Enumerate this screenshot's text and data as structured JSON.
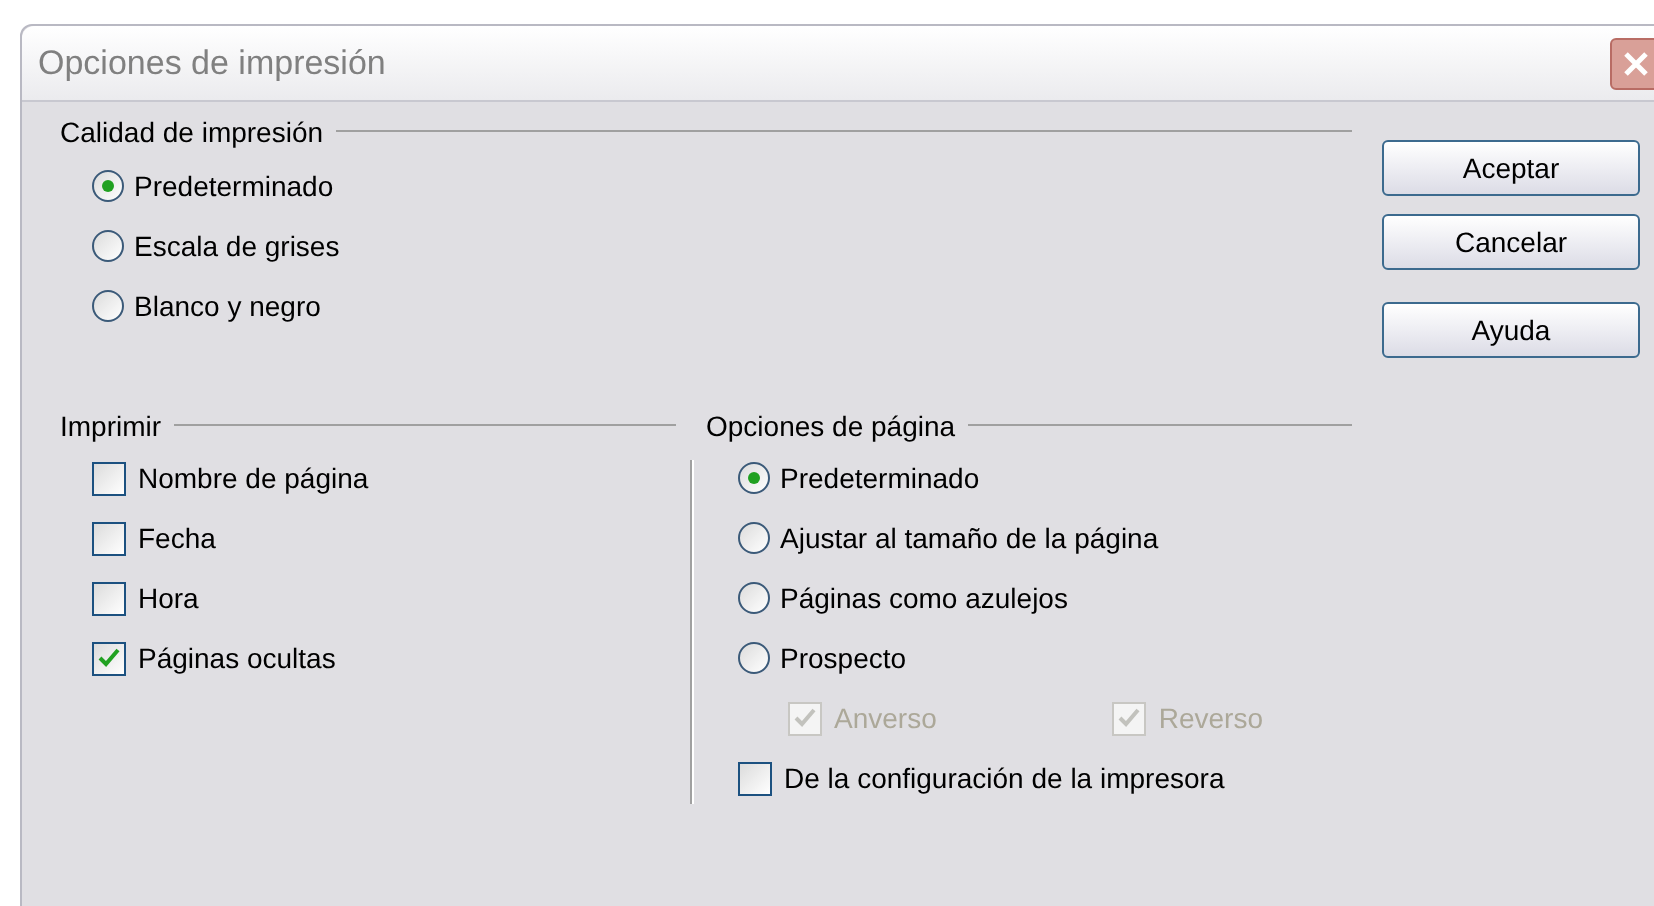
{
  "window": {
    "title": "Opciones de impresión"
  },
  "print_quality": {
    "label": "Calidad de impresión",
    "options": [
      {
        "label": "Predeterminado",
        "selected": true
      },
      {
        "label": "Escala de grises",
        "selected": false
      },
      {
        "label": "Blanco y negro",
        "selected": false
      }
    ]
  },
  "print": {
    "label": "Imprimir",
    "items": [
      {
        "label": "Nombre de página",
        "checked": false
      },
      {
        "label": "Fecha",
        "checked": false
      },
      {
        "label": "Hora",
        "checked": false
      },
      {
        "label": "Páginas ocultas",
        "checked": true
      }
    ]
  },
  "page_options": {
    "label": "Opciones de página",
    "items": [
      {
        "kind": "radio",
        "label": "Predeterminado",
        "selected": true
      },
      {
        "kind": "radio",
        "label": "Ajustar al tamaño de la página",
        "selected": false
      },
      {
        "kind": "radio",
        "label": "Páginas como azulejos",
        "selected": false
      },
      {
        "kind": "radio",
        "label": "Prospecto",
        "selected": false
      },
      {
        "kind": "subchecks",
        "items": [
          {
            "label": "Anverso",
            "checked": true,
            "disabled": true
          },
          {
            "label": "Reverso",
            "checked": true,
            "disabled": true
          }
        ]
      },
      {
        "kind": "checkbox",
        "label": "De la configuración de la impresora",
        "checked": false
      }
    ]
  },
  "buttons": [
    {
      "label": "Aceptar"
    },
    {
      "label": "Cancelar"
    },
    {
      "label": "Ayuda"
    }
  ]
}
